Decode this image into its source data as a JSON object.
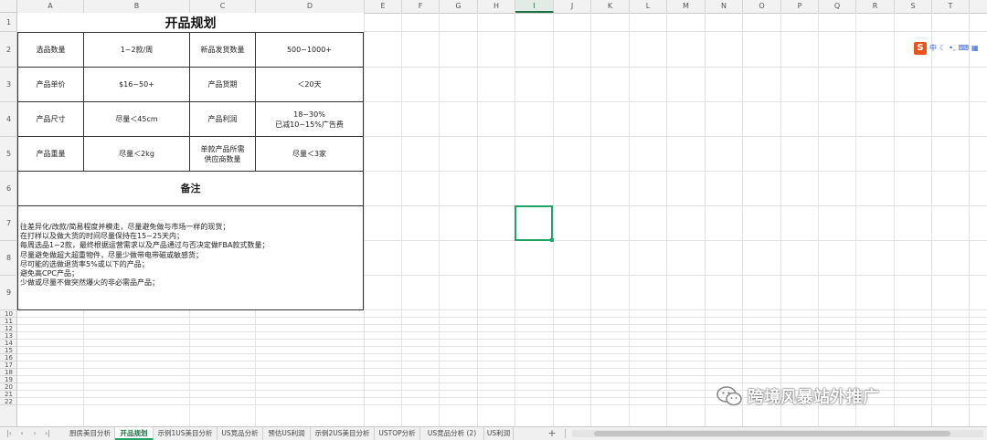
{
  "columns": [
    "A",
    "B",
    "C",
    "D",
    "E",
    "F",
    "G",
    "H",
    "I",
    "J",
    "K",
    "L",
    "M",
    "N",
    "O",
    "P",
    "Q",
    "R",
    "S",
    "T"
  ],
  "selected_column": "I",
  "rows": [
    "1",
    "2",
    "3",
    "4",
    "5",
    "6",
    "7",
    "8",
    "9",
    "10",
    "11",
    "12",
    "13",
    "14",
    "15",
    "16",
    "17",
    "18",
    "19",
    "20",
    "21",
    "22"
  ],
  "sheet": {
    "title": "开品规划",
    "table": [
      [
        "选品数量",
        "1~2款/周",
        "新品发货数量",
        "500~1000+"
      ],
      [
        "产品单价",
        "$16~50+",
        "产品货期",
        "＜20天"
      ],
      [
        "产品尺寸",
        "尽量＜45cm",
        "产品利润",
        "18~30%\n已减10~15%广告费"
      ],
      [
        "产品重量",
        "尽量＜2kg",
        "单款产品所需\n供应商数量",
        "尽量＜3家"
      ]
    ],
    "notes_title": "备注",
    "notes": [
      "往差异化/改款/简易程度并模走，尽量避免做与市场一样的现货；",
      "在打样以及做大货的时间尽量保持在15~25天内；",
      "每周选品1~2款，最终根据运营需求以及产品通过与否决定做FBA款式数量；",
      "尽量避免做超大超重物件，尽量少做带电带磁或敏感货；",
      "尽可能的选做退货率5%或以下的产品；",
      "避免高CPC产品；",
      "少做或尽量不做突然爆火的非必需品产品；"
    ]
  },
  "ime": {
    "label": "中",
    "icons": [
      "moon-icon",
      "punctuation-icon",
      "keyboard-icon",
      "grid-icon"
    ]
  },
  "watermark": "跨境风暴站外推广",
  "sheet_tabs": [
    "厨房美目分析",
    "开品规划",
    "示例1US美目分析",
    "US竞品分析",
    "预估US利润",
    "示例2US美目分析",
    "USTOP分析",
    "US竞品分析 (2)",
    "US利润"
  ],
  "active_tab": "开品规划",
  "colors": {
    "accent": "#21a366",
    "grid": "#e3e3e3",
    "header_bg": "#f2f2f2"
  }
}
